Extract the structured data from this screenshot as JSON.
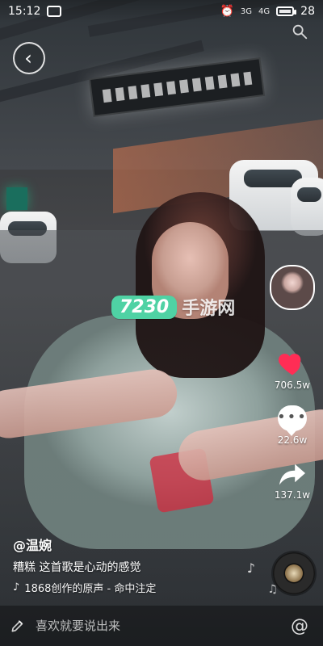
{
  "status_bar": {
    "time": "15:12",
    "network_3g": "3G",
    "network_4g": "4G",
    "battery": "28"
  },
  "video": {
    "watermark": {
      "badge": "7230",
      "text": "手游网"
    }
  },
  "right_actions": {
    "likes": "706.5w",
    "comments": "22.6w",
    "shares": "137.1w"
  },
  "post": {
    "username": "@温婉",
    "caption": "糟糕  这首歌是心动的感觉",
    "music": "1868创作的原声 - 命中注定"
  },
  "comment": {
    "placeholder": "喜欢就要说出来"
  },
  "icons": {
    "back": "chevron-left-icon",
    "search": "search-icon",
    "like": "heart-icon",
    "comment": "comment-bubble-icon",
    "share": "share-arrow-icon",
    "music": "music-note-icon",
    "at": "at-icon",
    "edit": "pencil-icon"
  },
  "colors": {
    "like_red": "#ff2d55",
    "watermark_green": "#4fd2a4"
  }
}
